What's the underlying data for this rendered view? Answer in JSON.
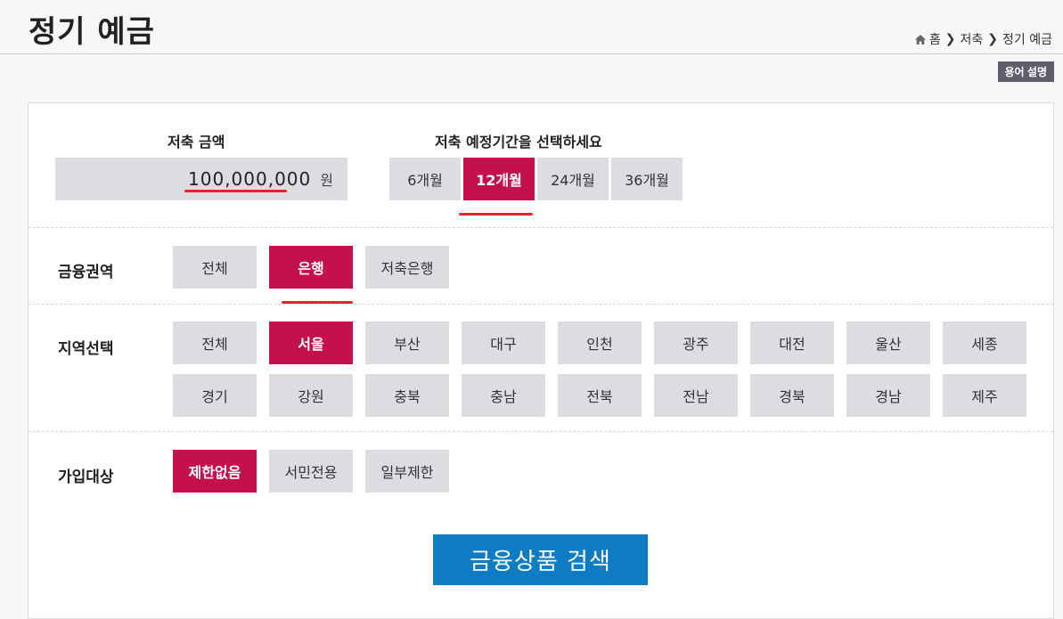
{
  "header": {
    "title": "정기 예금",
    "breadcrumb": [
      "홈",
      "저축",
      "정기 예금"
    ],
    "glossary_label": "용어 설명"
  },
  "amount": {
    "label": "저축 금액",
    "value": "100,000,000",
    "unit": "원"
  },
  "period": {
    "label": "저축 예정기간을 선택하세요",
    "options": [
      "6개월",
      "12개월",
      "24개월",
      "36개월"
    ],
    "selected": "12개월"
  },
  "financial_sector": {
    "label": "금융권역",
    "options": [
      "전체",
      "은행",
      "저축은행"
    ],
    "selected": "은행"
  },
  "region": {
    "label": "지역선택",
    "options": [
      "전체",
      "서울",
      "부산",
      "대구",
      "인천",
      "광주",
      "대전",
      "울산",
      "세종",
      "경기",
      "강원",
      "충북",
      "충남",
      "전북",
      "전남",
      "경북",
      "경남",
      "제주"
    ],
    "selected": "서울"
  },
  "eligibility": {
    "label": "가입대상",
    "options": [
      "제한없음",
      "서민전용",
      "일부제한"
    ],
    "selected": "제한없음"
  },
  "search_button": "금융상품 검색",
  "colors": {
    "accent": "#c4104f",
    "button_bg": "#dcdde1",
    "search_bg": "#0d7cc2",
    "underline": "#e0262d"
  }
}
